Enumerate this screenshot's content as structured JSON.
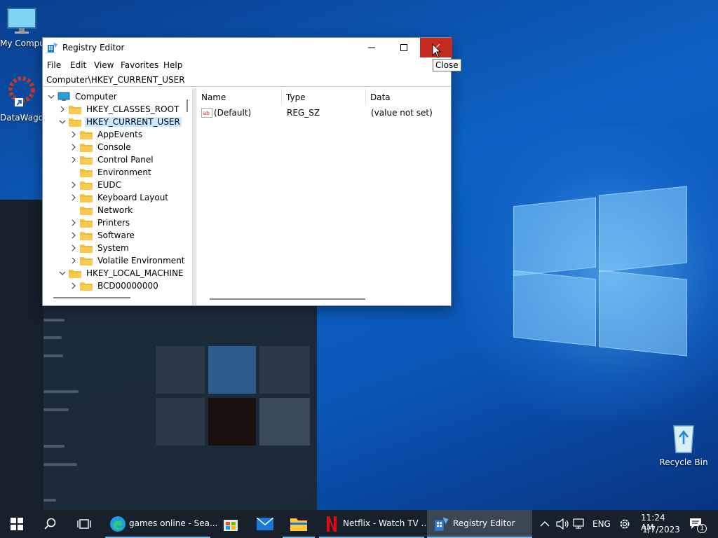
{
  "desktop": {
    "icons": [
      {
        "label": "My Computer"
      },
      {
        "label": "DataWagon"
      },
      {
        "label": "Recycle Bin"
      }
    ]
  },
  "window": {
    "title": "Registry Editor",
    "menu": [
      "File",
      "Edit",
      "View",
      "Favorites",
      "Help"
    ],
    "address": "Computer\\HKEY_CURRENT_USER",
    "tooltip": "Close",
    "tree": [
      {
        "label": "Computer",
        "level": 0,
        "expanded": true,
        "type": "computer"
      },
      {
        "label": "HKEY_CLASSES_ROOT",
        "level": 1,
        "expanded": false,
        "type": "folder"
      },
      {
        "label": "HKEY_CURRENT_USER",
        "level": 1,
        "expanded": true,
        "type": "folder",
        "selected": true
      },
      {
        "label": "AppEvents",
        "level": 2,
        "expanded": false,
        "type": "folder"
      },
      {
        "label": "Console",
        "level": 2,
        "expanded": false,
        "type": "folder"
      },
      {
        "label": "Control Panel",
        "level": 2,
        "expanded": false,
        "type": "folder"
      },
      {
        "label": "Environment",
        "level": 2,
        "expanded": null,
        "type": "folder"
      },
      {
        "label": "EUDC",
        "level": 2,
        "expanded": false,
        "type": "folder"
      },
      {
        "label": "Keyboard Layout",
        "level": 2,
        "expanded": false,
        "type": "folder"
      },
      {
        "label": "Network",
        "level": 2,
        "expanded": null,
        "type": "folder"
      },
      {
        "label": "Printers",
        "level": 2,
        "expanded": false,
        "type": "folder"
      },
      {
        "label": "Software",
        "level": 2,
        "expanded": false,
        "type": "folder"
      },
      {
        "label": "System",
        "level": 2,
        "expanded": false,
        "type": "folder"
      },
      {
        "label": "Volatile Environment",
        "level": 2,
        "expanded": false,
        "type": "folder"
      },
      {
        "label": "HKEY_LOCAL_MACHINE",
        "level": 1,
        "expanded": true,
        "type": "folder"
      },
      {
        "label": "BCD00000000",
        "level": 2,
        "expanded": false,
        "type": "folder"
      }
    ],
    "columns": [
      "Name",
      "Type",
      "Data"
    ],
    "values": [
      {
        "name": "(Default)",
        "type": "REG_SZ",
        "data": "(value not set)"
      }
    ]
  },
  "taskbar": {
    "items": [
      {
        "label": "games online - Sea...",
        "icon": "edge-icon"
      },
      {
        "label": "Netflix - Watch TV ...",
        "icon": "netflix-icon"
      },
      {
        "label": "Registry Editor",
        "icon": "regedit-icon",
        "active": true
      }
    ],
    "tray": {
      "language": "ENG",
      "time": "11:24 AM",
      "date": "1/7/2023",
      "notifications": "1"
    }
  }
}
